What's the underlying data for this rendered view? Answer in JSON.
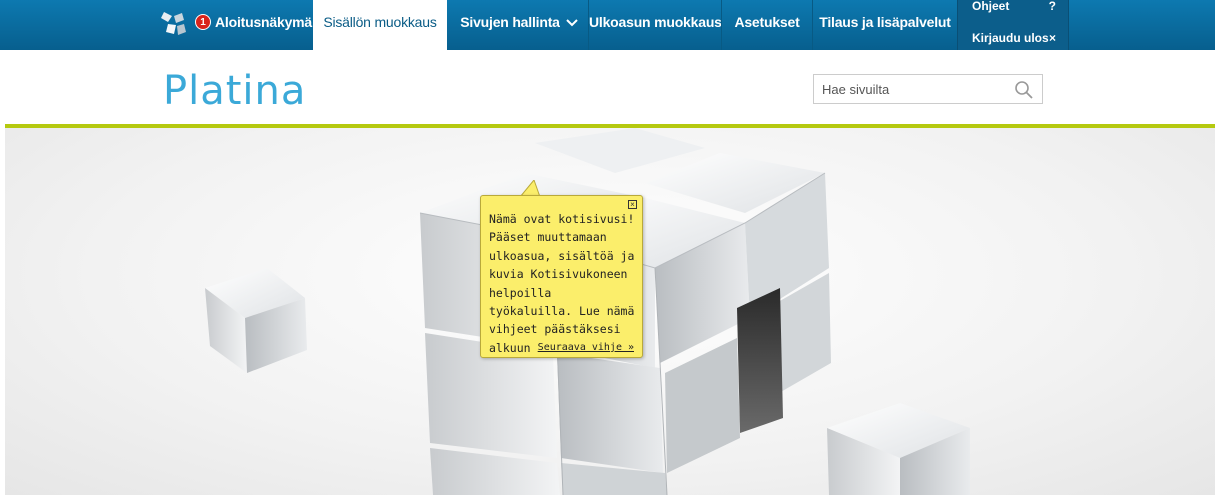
{
  "topbar": {
    "notification_count": "1",
    "home_label": "Aloitusnäkymä",
    "nav": [
      {
        "label": "Sisällön muokkaus",
        "active": true
      },
      {
        "label": "Sivujen hallinta"
      },
      {
        "label": "Ulkoasun muokkaus"
      },
      {
        "label": "Asetukset"
      },
      {
        "label": "Tilaus ja lisäpalvelut"
      }
    ],
    "help_label": "Ohjeet",
    "help_mark": "?",
    "logout_label": "Kirjaudu ulos",
    "logout_mark": "×"
  },
  "header": {
    "site_title": "Platina",
    "search_placeholder": "Hae sivuilta"
  },
  "tooltip": {
    "text": "Nämä ovat kotisivusi! Pääset muuttamaan ulkoasua, sisältöä ja kuvia Kotisivukoneen helpoilla työkaluilla. Lue nämä vihjeet päästäksesi alkuun",
    "next_link": "Seuraava vihje »",
    "close_icon": "×"
  },
  "colors": {
    "topbar": "#0a6fa3",
    "brand": "#3ba9d8",
    "accent_line": "#b5c90f",
    "tooltip_bg": "#fbee6b",
    "badge": "#d9241c"
  }
}
